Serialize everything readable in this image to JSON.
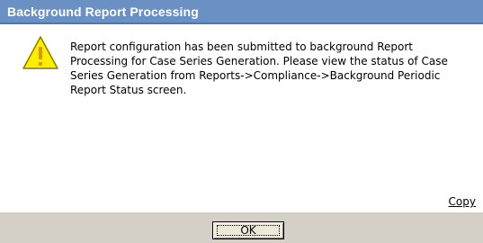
{
  "dialog": {
    "title": "Background Report Processing",
    "icon": "warning-icon",
    "message": "Report configuration has been submitted to background Report Processing for Case Series Generation. Please view the status of Case Series Generation from Reports->Compliance->Background Periodic Report Status screen.",
    "copy_label": "Copy",
    "ok_label": "OK"
  },
  "colors": {
    "titlebar": "#6b91c4",
    "footer": "#d4d0c8",
    "warning_fill": "#ffee00",
    "warning_exclamation": "#d49a00"
  }
}
